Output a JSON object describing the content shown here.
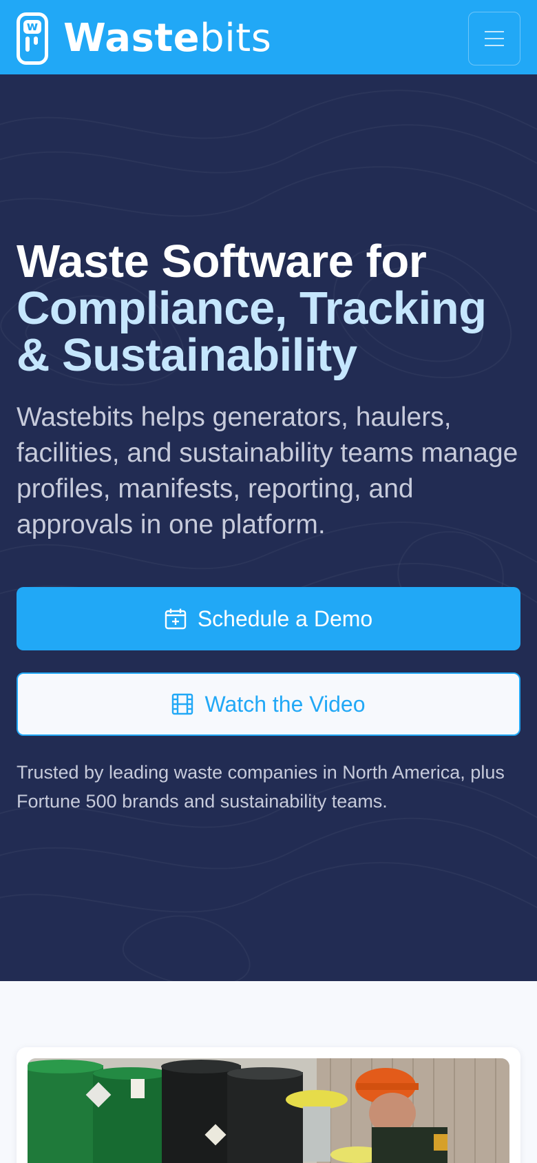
{
  "header": {
    "brand_bold": "Waste",
    "brand_light": "bits",
    "logo_mark_letter": "w",
    "menu_icon": "hamburger-menu-icon",
    "background_color": "#21a8f6"
  },
  "hero": {
    "headline_line1": "Waste Software for",
    "headline_line2": "Compliance, Tracking & Sustainability",
    "subtext": "Wastebits helps generators, haulers, facilities, and sustainability teams manage profiles, manifests, reporting, and approvals in one platform.",
    "primary_cta": {
      "label": "Schedule a Demo",
      "icon": "calendar-plus-icon"
    },
    "secondary_cta": {
      "label": "Watch the Video",
      "icon": "film-icon"
    },
    "trusted_text": "Trusted by leading waste companies in North America, plus Fortune 500 brands and sustainability teams.",
    "background_color": "#222c53",
    "headline_accent_color": "#c5e6fd"
  },
  "feature_card": {
    "image": "workers-with-waste-drums-photo"
  }
}
